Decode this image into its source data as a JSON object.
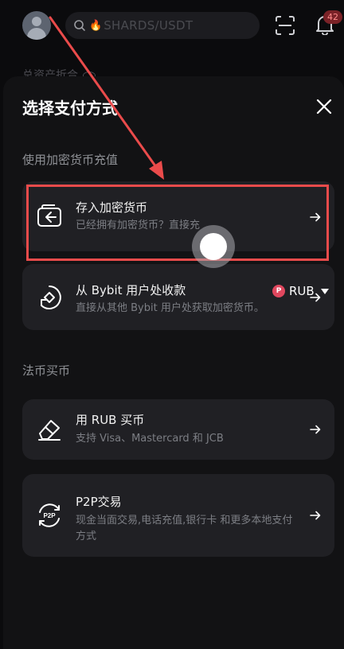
{
  "header": {
    "search_placeholder": "SHARDS/USDT",
    "notification_count": "42",
    "assets_label": "总资产折合"
  },
  "sheet": {
    "title": "选择支付方式",
    "crypto_section_label": "使用加密货币充值",
    "options_crypto": [
      {
        "title": "存入加密货币",
        "desc": "已经拥有加密货币？直接充"
      },
      {
        "title": "从 Bybit 用户处收款",
        "desc": "直接从其他 Bybit 用户处获取加密货币。"
      }
    ],
    "fiat_section_label": "法币买币",
    "fiat_currency": {
      "symbol": "P",
      "code": "RUB"
    },
    "options_fiat": [
      {
        "title": "用 RUB 买币",
        "desc": "支持 Visa、Mastercard 和 JCB"
      },
      {
        "title": "P2P交易",
        "desc": "现金当面交易,电话充值,银行卡 和更多本地支付方式"
      }
    ]
  },
  "colors": {
    "background": "#0b0b0d",
    "sheet": "#121214",
    "card": "#202024",
    "annotation": "#ea4b4b",
    "rub_badge": "#e0475e"
  }
}
